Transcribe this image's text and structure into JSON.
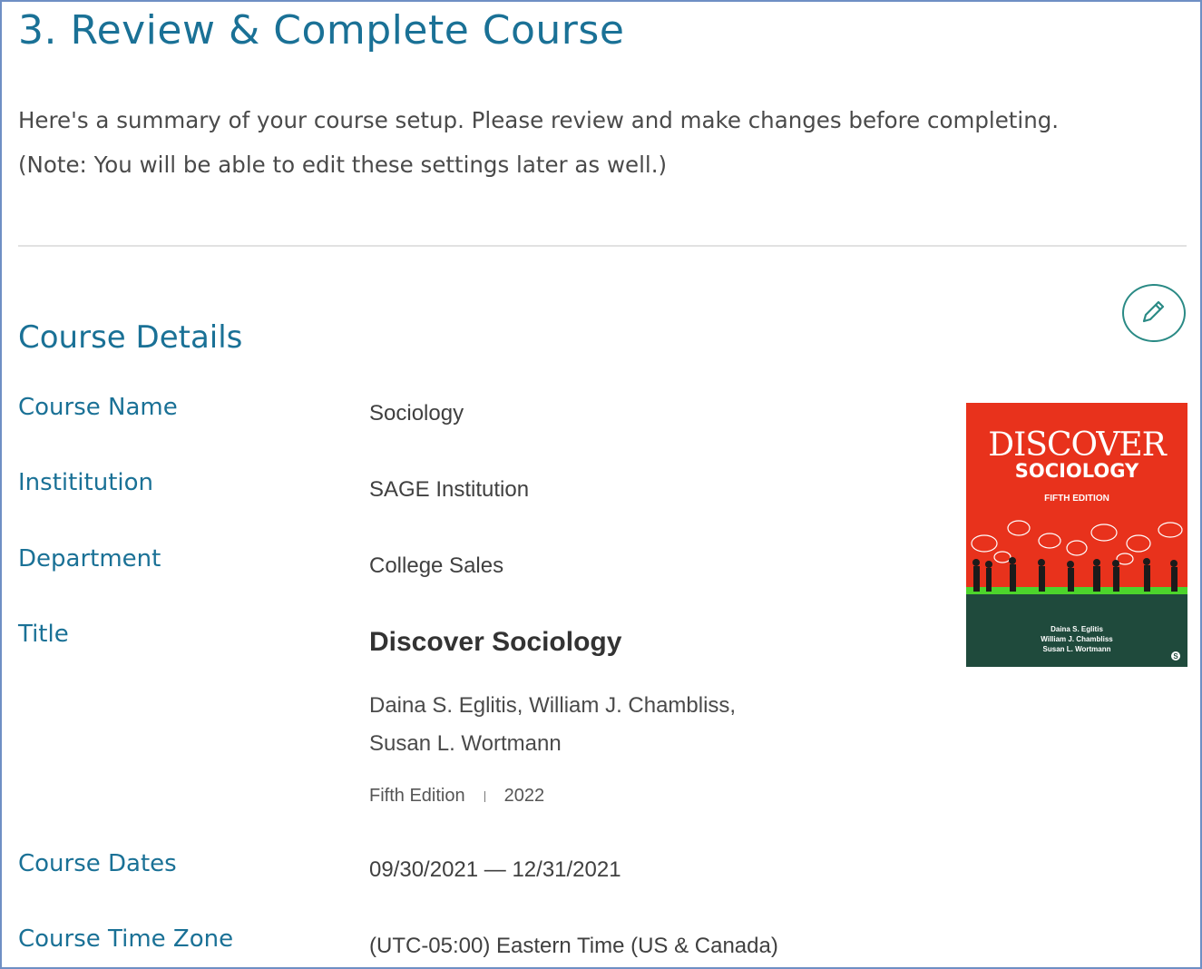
{
  "page": {
    "title": "3. Review & Complete Course",
    "intro_line1": "Here's a summary of your course setup. Please review and make changes before completing.",
    "intro_line2": "(Note: You will be able to edit these settings later as well.)"
  },
  "section": {
    "title": "Course Details",
    "edit_icon": "pencil-icon"
  },
  "fields": {
    "course_name_label": "Course Name",
    "course_name_value": "Sociology",
    "institution_label": "Instititution",
    "institution_value": "SAGE Institution",
    "department_label": "Department",
    "department_value": "College Sales",
    "title_label": "Title",
    "course_dates_label": "Course Dates",
    "course_dates_value": "09/30/2021 — 12/31/2021",
    "time_zone_label": "Course Time Zone",
    "time_zone_value": "(UTC-05:00) Eastern Time (US & Canada)"
  },
  "book": {
    "title": "Discover Sociology",
    "authors_line1": "Daina S. Eglitis, William J. Chambliss,",
    "authors_line2": "Susan L. Wortmann",
    "edition": "Fifth Edition",
    "year": "2022",
    "cover": {
      "title_top": "DISCOVER",
      "title_bottom": "SOCIOLOGY",
      "edition": "FIFTH EDITION",
      "author1": "Daina S. Eglitis",
      "author2": "William J. Chambliss",
      "author3": "Susan L. Wortmann",
      "publisher_mark": "S",
      "color_top": "#e8321c",
      "color_bottom": "#1f4a3c",
      "color_stripe": "#4cd42c"
    }
  },
  "colors": {
    "accent": "#1a7196",
    "border": "#6f8fc4",
    "edit_button": "#2a8a85"
  }
}
